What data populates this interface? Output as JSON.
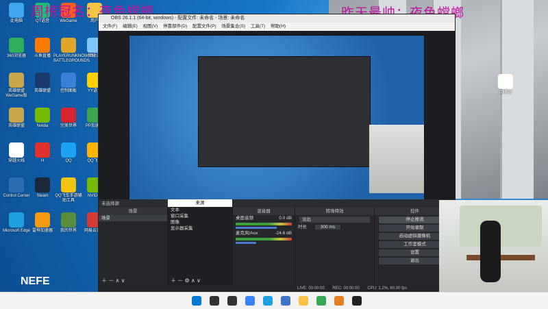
{
  "banner": {
    "left": "周榜冠名：夜色螳螂",
    "right": "昨天最帅：夜色螳螂"
  },
  "desktop": {
    "icons": [
      {
        "label": "此电脑",
        "icon": "monitor-icon",
        "color": "#3fa7ef"
      },
      {
        "label": "QT语音",
        "icon": "qt-icon",
        "color": "#1cbf7a"
      },
      {
        "label": "WeGame",
        "icon": "wegame-icon",
        "color": "#f25f1f"
      },
      {
        "label": "用户",
        "icon": "folder-icon",
        "color": "#f6c444"
      },
      {
        "label": "360浏览器",
        "icon": "browser-icon",
        "color": "#2eb05a"
      },
      {
        "label": "斗鱼直播",
        "icon": "douyu-icon",
        "color": "#ff7a00"
      },
      {
        "label": "PLAYERUNKNOWN'S BATTLEGROUNDS",
        "icon": "pubg-icon",
        "color": "#e0a62a"
      },
      {
        "label": "回收站",
        "icon": "recycle-bin-icon",
        "color": "#7fc7ff"
      },
      {
        "label": "英雄联盟WeGame版",
        "icon": "lol-icon",
        "color": "#caa64a"
      },
      {
        "label": "英雄联盟",
        "icon": "lol-icon",
        "color": "#1c3a6c"
      },
      {
        "label": "控制面板",
        "icon": "control-panel-icon",
        "color": "#3c7fd9"
      },
      {
        "label": "YY语音",
        "icon": "yy-icon",
        "color": "#ffd000"
      },
      {
        "label": "英雄联盟",
        "icon": "lol-icon",
        "color": "#caa64a"
      },
      {
        "label": "Nvidia",
        "icon": "nvidia-icon",
        "color": "#76b900"
      },
      {
        "label": "完美世界",
        "icon": "pw-icon",
        "color": "#d9232e"
      },
      {
        "label": "PP加速器",
        "icon": "pp-icon",
        "color": "#3ba54a"
      },
      {
        "label": "穿越火线",
        "icon": "cf-icon",
        "color": "#fff"
      },
      {
        "label": "H",
        "icon": "h-icon",
        "color": "#e0322c"
      },
      {
        "label": "QQ",
        "icon": "qq-icon",
        "color": "#1da1f2"
      },
      {
        "label": "QQ飞车",
        "icon": "qq-speed-icon",
        "color": "#ffb400"
      },
      {
        "label": "Control Center",
        "icon": "control-center-icon",
        "color": "#2b6cb2"
      },
      {
        "label": "Steam",
        "icon": "steam-icon",
        "color": "#1b2838"
      },
      {
        "label": "QQ飞车手游辅助工具",
        "icon": "qqspeed-tool-icon",
        "color": "#f1c40f"
      },
      {
        "label": "NVIDIA",
        "icon": "nvidia-icon",
        "color": "#76b900"
      },
      {
        "label": "Microsoft Edge",
        "icon": "edge-icon",
        "color": "#1fa0e0"
      },
      {
        "label": "雷神加速器",
        "icon": "thunder-icon",
        "color": "#f39c12"
      },
      {
        "label": "我的世界",
        "icon": "minecraft-icon",
        "color": "#5a8d3a"
      },
      {
        "label": "网易云音乐",
        "icon": "netease-icon",
        "color": "#d43c33"
      }
    ],
    "right_icon": {
      "label": "回收站",
      "icon": "recycle-bin-icon",
      "color": "#ffffff"
    }
  },
  "obs": {
    "title": "OBS 26.1.1 (64-bit, windows) - 配置文件: 未命名 - 场景: 未命名",
    "menu": [
      "文件(F)",
      "编辑(E)",
      "视图(V)",
      "停靠部件(D)",
      "配置文件(P)",
      "场景集合(S)",
      "工具(T)",
      "帮助(H)"
    ],
    "docks": {
      "scenes": {
        "header": "场景",
        "items": [
          "场景"
        ]
      },
      "sources": {
        "header": "来源",
        "items": [
          "文本",
          "窗口采集",
          "图像",
          "显示器采集"
        ]
      },
      "mixer": {
        "header": "混音器",
        "channels": [
          {
            "name": "桌面音频",
            "db": "0.0 dB"
          },
          {
            "name": "麦克风/Aux",
            "db": "-24.6 dB"
          }
        ]
      },
      "transitions": {
        "header": "转场特效",
        "type": "淡出",
        "duration_label": "时长",
        "duration": "300 ms"
      },
      "controls": {
        "header": "控件",
        "buttons": [
          "停止推流",
          "开始录制",
          "启动虚拟摄像机",
          "工作室模式",
          "设置",
          "退出"
        ]
      }
    },
    "status": {
      "live": "LIVE: 00:00:00",
      "rec": "REC: 00:00:00",
      "cpu": "CPU: 1.2%, 60.00 fps"
    },
    "no_source_label": "未选择源"
  },
  "taskbar": {
    "icons": [
      {
        "name": "windows-start-icon",
        "color": "#0078d4"
      },
      {
        "name": "search-icon",
        "color": "#333"
      },
      {
        "name": "task-view-icon",
        "color": "#333"
      },
      {
        "name": "widgets-icon",
        "color": "#3b82f6"
      },
      {
        "name": "edge-icon",
        "color": "#1fa0e0"
      },
      {
        "name": "store-icon",
        "color": "#3c75c9"
      },
      {
        "name": "file-explorer-icon",
        "color": "#f6c444"
      },
      {
        "name": "chrome-icon",
        "color": "#34a853"
      },
      {
        "name": "app-icon",
        "color": "#e67e22"
      },
      {
        "name": "obs-icon",
        "color": "#222"
      }
    ]
  },
  "logo": "NEFE"
}
